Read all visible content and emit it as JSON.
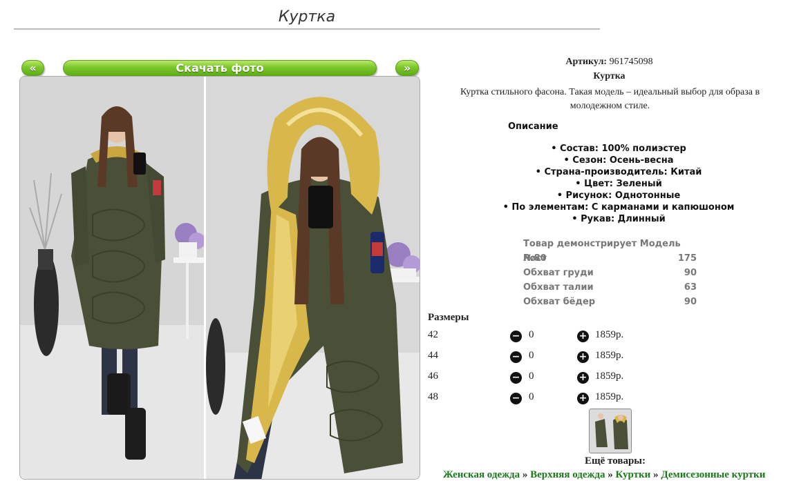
{
  "page": {
    "title": "Куртка"
  },
  "gallery": {
    "prev_label": "«",
    "download_label": "Скачать фото",
    "next_label": "»"
  },
  "product": {
    "article_label": "Артикул:",
    "article_value": "961745098",
    "name": "Куртка",
    "description": "Куртка стильного фасона. Такая модель – идеальный выбор для образа в молодежном стиле.",
    "description_title": "Описание",
    "attributes": [
      "Состав: 100% полиэстер",
      "Сезон: Осень-весна",
      "Страна-производитель: Китай",
      "Цвет: Зеленый",
      "Рисунок: Однотонные",
      "По элементам: С карманами и капюшоном",
      "Рукав: Длинный"
    ],
    "model": [
      {
        "label": "Товар демонстрирует Модель №80",
        "value": ""
      },
      {
        "label": "Рост",
        "value": "175"
      },
      {
        "label": "Обхват груди",
        "value": "90"
      },
      {
        "label": "Обхват талии",
        "value": "63"
      },
      {
        "label": "Обхват бёдер",
        "value": "90"
      }
    ]
  },
  "sizes": {
    "label": "Размеры",
    "minus_icon": "minus-circle-icon",
    "plus_icon": "plus-circle-icon",
    "rows": [
      {
        "size": "42",
        "qty": "0",
        "price": "1859р."
      },
      {
        "size": "44",
        "qty": "0",
        "price": "1859р."
      },
      {
        "size": "46",
        "qty": "0",
        "price": "1859р."
      },
      {
        "size": "48",
        "qty": "0",
        "price": "1859р."
      }
    ]
  },
  "more": {
    "label": "Ещё товары:",
    "breadcrumb": [
      "Женская одежда",
      "Верхняя одежда",
      "Куртки",
      "Демисезонные куртки"
    ],
    "separator": "»"
  },
  "colors": {
    "accent_green": "#7cc72a",
    "link_green": "#1a7a1a",
    "jacket_olive": "#4a5038",
    "hood_gold": "#d8b84a"
  }
}
